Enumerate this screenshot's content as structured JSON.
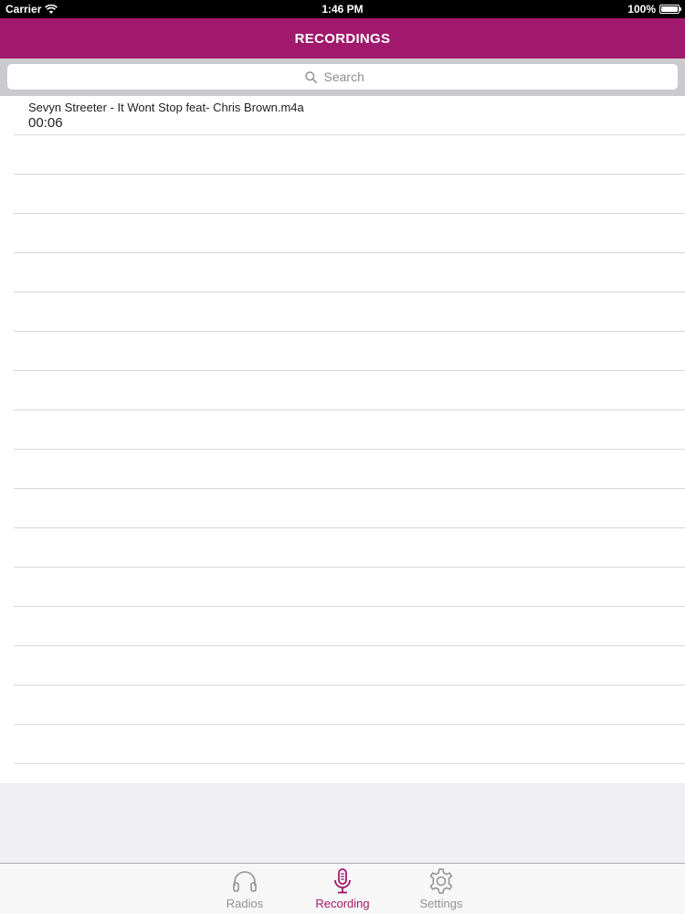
{
  "status_bar": {
    "carrier": "Carrier",
    "time": "1:46 PM",
    "battery": "100%",
    "icons": [
      "wifi-icon",
      "battery-icon"
    ]
  },
  "nav_bar": {
    "title": "RECORDINGS"
  },
  "search": {
    "placeholder": "Search",
    "icon": "search-icon"
  },
  "recordings": [
    {
      "title": "Sevyn Streeter - It Wont Stop feat- Chris Brown.m4a",
      "duration": "00:06"
    }
  ],
  "tab_bar": {
    "active": "recording",
    "accent_color": "#a0196d",
    "inactive_color": "#929292",
    "tabs": [
      {
        "id": "radios",
        "label": "Radios",
        "icon": "headphones-icon"
      },
      {
        "id": "recording",
        "label": "Recording",
        "icon": "microphone-icon"
      },
      {
        "id": "settings",
        "label": "Settings",
        "icon": "gear-icon"
      }
    ]
  },
  "colors": {
    "brand": "#a0196d",
    "background": "#efeff4"
  }
}
